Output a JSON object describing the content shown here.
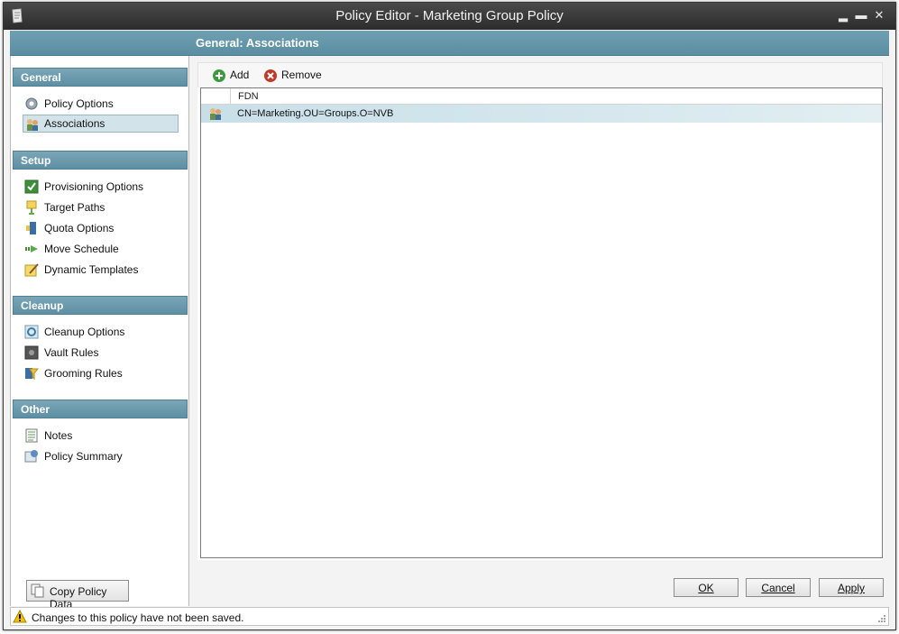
{
  "window": {
    "title": "Policy Editor - Marketing Group Policy"
  },
  "header": {
    "title": "General: Associations"
  },
  "sidebar": {
    "groups": [
      {
        "label": "General",
        "items": [
          {
            "label": "Policy Options",
            "icon": "gear-icon"
          },
          {
            "label": "Associations",
            "icon": "users-icon",
            "selected": true
          }
        ]
      },
      {
        "label": "Setup",
        "items": [
          {
            "label": "Provisioning Options",
            "icon": "checkbox-icon"
          },
          {
            "label": "Target Paths",
            "icon": "target-icon"
          },
          {
            "label": "Quota Options",
            "icon": "quota-icon"
          },
          {
            "label": "Move Schedule",
            "icon": "move-icon"
          },
          {
            "label": "Dynamic Templates",
            "icon": "template-icon"
          }
        ]
      },
      {
        "label": "Cleanup",
        "items": [
          {
            "label": "Cleanup Options",
            "icon": "cleanup-icon"
          },
          {
            "label": "Vault Rules",
            "icon": "vault-icon"
          },
          {
            "label": "Grooming Rules",
            "icon": "filter-icon"
          }
        ]
      },
      {
        "label": "Other",
        "items": [
          {
            "label": "Notes",
            "icon": "notes-icon"
          },
          {
            "label": "Policy Summary",
            "icon": "summary-icon"
          }
        ]
      }
    ],
    "copy_button": "Copy Policy Data"
  },
  "toolbar": {
    "add_label": "Add",
    "remove_label": "Remove"
  },
  "grid": {
    "columns": [
      "FDN"
    ],
    "rows": [
      {
        "fdn": "CN=Marketing.OU=Groups.O=NVB"
      }
    ]
  },
  "buttons": {
    "ok": "OK",
    "cancel": "Cancel",
    "apply": "Apply"
  },
  "status": {
    "message": "Changes to this policy have not been saved."
  },
  "colors": {
    "accent": "#5e8fa3",
    "selected": "#d2e3ea"
  }
}
